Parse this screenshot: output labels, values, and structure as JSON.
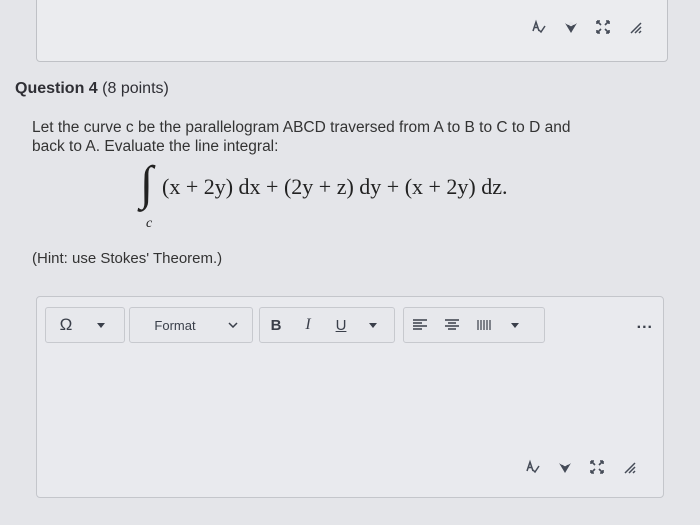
{
  "top_editor": {
    "icons": [
      "spellcheck-icon",
      "accessibility-icon",
      "fullscreen-icon",
      "resize-icon"
    ]
  },
  "question": {
    "title": "Question 4",
    "points": "(8 points)",
    "line1": "Let the curve c be the parallelogram ABCD traversed from A to B to C to D and",
    "line2": "back to A. Evaluate the line integral:",
    "integral_subscript": "c",
    "integral_expr": "(x + 2y) dx + (2y + z) dy + (x + 2y) dz.",
    "hint": "(Hint: use Stokes' Theorem.)"
  },
  "editor": {
    "toolbar": {
      "special_char_label": "Ω",
      "format_label": "Format",
      "bold_label": "B",
      "italic_label": "I",
      "underline_label": "U",
      "more_label": "..."
    },
    "icons": [
      "spellcheck-icon",
      "accessibility-icon",
      "fullscreen-icon",
      "resize-icon"
    ]
  }
}
